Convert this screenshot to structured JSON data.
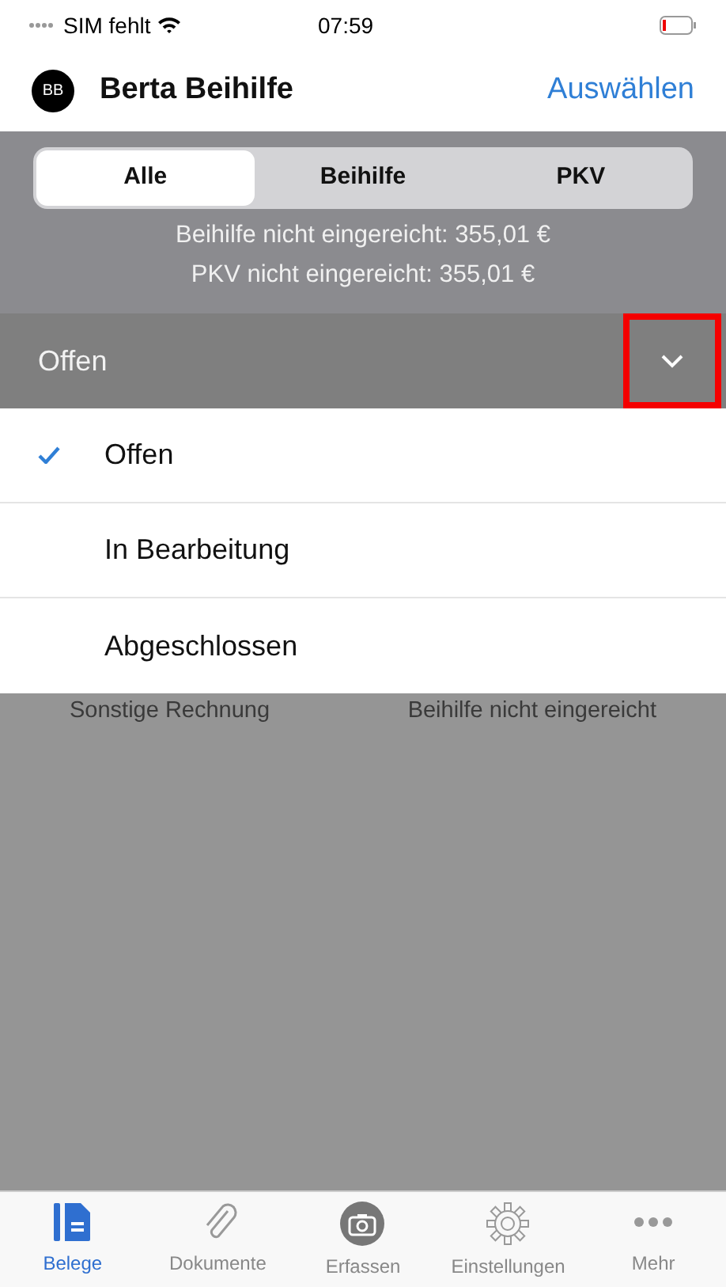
{
  "status_bar": {
    "carrier": "SIM fehlt",
    "time": "07:59"
  },
  "header": {
    "avatar": "BB",
    "title": "Berta Beihilfe",
    "action": "Auswählen"
  },
  "segments": [
    {
      "label": "Alle",
      "selected": true
    },
    {
      "label": "Beihilfe",
      "selected": false
    },
    {
      "label": "PKV",
      "selected": false
    }
  ],
  "summary": [
    "Beihilfe nicht eingereicht: 355,01 €",
    "PKV nicht eingereicht: 355,01 €"
  ],
  "filter": {
    "label": "Offen",
    "expanded": true,
    "chevron_highlighted": true
  },
  "options": [
    {
      "label": "Offen",
      "selected": true
    },
    {
      "label": "In Bearbeitung",
      "selected": false
    },
    {
      "label": "Abgeschlossen",
      "selected": false
    }
  ],
  "background_row": {
    "column_1": "Sonstige Rechnung",
    "column_2": "Beihilfe nicht eingereicht"
  },
  "tab_bar": [
    {
      "label": "Belege",
      "kind": "document",
      "selected": true
    },
    {
      "label": "Dokumente",
      "kind": "clip",
      "selected": false
    },
    {
      "label": "Erfassen",
      "kind": "camera",
      "selected": false
    },
    {
      "label": "Einstellungen",
      "kind": "gear",
      "selected": false
    },
    {
      "label": "Mehr",
      "kind": "dots",
      "selected": false
    }
  ]
}
